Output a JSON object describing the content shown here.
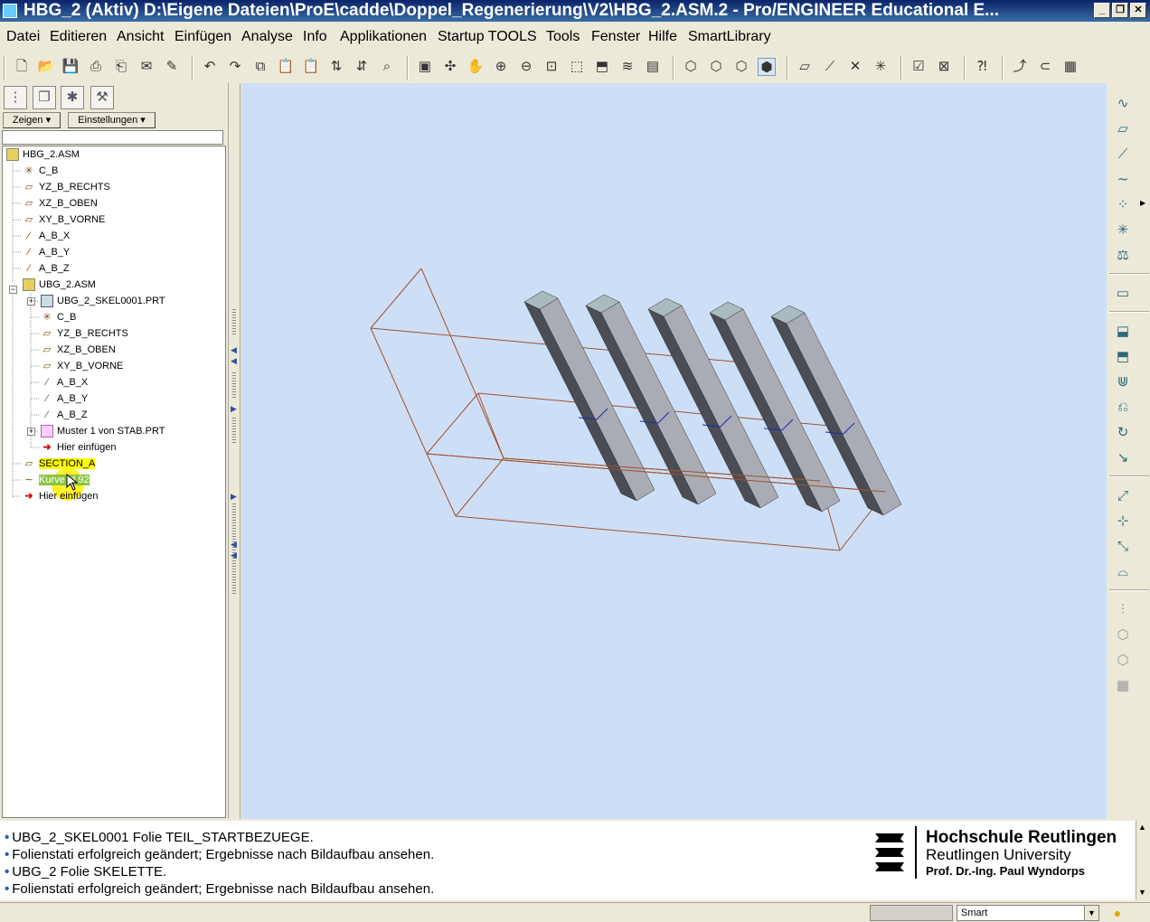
{
  "window": {
    "title": "HBG_2 (Aktiv) D:\\Eigene Dateien\\ProE\\cadde\\Doppel_Regenerierung\\V2\\HBG_2.ASM.2 - Pro/ENGINEER Educational E...",
    "minimize": "_",
    "maximize": "❐",
    "close": "✕"
  },
  "menu": [
    "Datei",
    "Editieren",
    "Ansicht",
    "Einfügen",
    "Analyse",
    "Info",
    "Applikationen",
    "Startup TOOLS",
    "Tools",
    "Fenster",
    "Hilfe",
    "SmartLibrary"
  ],
  "panel": {
    "show_button": "Zeigen ▾",
    "settings_button": "Einstellungen ▾"
  },
  "tree": [
    {
      "label": "HBG_2.ASM",
      "icon": "assembly-icon"
    },
    {
      "label": "C_B",
      "icon": "csys-icon"
    },
    {
      "label": "YZ_B_RECHTS",
      "icon": "plane-icon"
    },
    {
      "label": "XZ_B_OBEN",
      "icon": "plane-icon"
    },
    {
      "label": "XY_B_VORNE",
      "icon": "plane-icon"
    },
    {
      "label": "A_B_X",
      "icon": "axis-icon"
    },
    {
      "label": "A_B_Y",
      "icon": "axis-icon"
    },
    {
      "label": "A_B_Z",
      "icon": "axis-icon"
    },
    {
      "label": "UBG_2.ASM",
      "icon": "assembly-icon"
    },
    {
      "label": "UBG_2_SKEL0001.PRT",
      "icon": "part-icon"
    },
    {
      "label": "C_B",
      "icon": "csys-icon"
    },
    {
      "label": "YZ_B_RECHTS",
      "icon": "plane-icon"
    },
    {
      "label": "XZ_B_OBEN",
      "icon": "plane-icon"
    },
    {
      "label": "XY_B_VORNE",
      "icon": "plane-icon"
    },
    {
      "label": "A_B_X",
      "icon": "axis-icon"
    },
    {
      "label": "A_B_Y",
      "icon": "axis-icon"
    },
    {
      "label": "A_B_Z",
      "icon": "axis-icon"
    },
    {
      "label": "Muster 1 von STAB.PRT",
      "icon": "pattern-icon"
    },
    {
      "label": "Hier einfügen",
      "icon": "insert-here-icon"
    },
    {
      "label": "SECTION_A",
      "icon": "plane-icon"
    },
    {
      "label": "Kurve id 92",
      "icon": "curve-icon"
    },
    {
      "label": "Hier einfügen",
      "icon": "insert-here-icon"
    }
  ],
  "messages": [
    "UBG_2_SKEL0001 Folie TEIL_STARTBEZUEGE.",
    "Folienstati erfolgreich geändert; Ergebnisse nach Bildaufbau ansehen.",
    "UBG_2 Folie SKELETTE.",
    "Folienstati erfolgreich geändert; Ergebnisse nach Bildaufbau ansehen."
  ],
  "logo": {
    "line1": "Hochschule Reutlingen",
    "line2": "Reutlingen University",
    "line3": "Prof. Dr.-Ing. Paul Wyndorps"
  },
  "status": {
    "filter_value": "Smart"
  },
  "colors": {
    "viewport_bg": "#cddff7",
    "wireframe": "#a0522d",
    "bar_top": "#aabbc0",
    "bar_side_dark": "#4a4d55",
    "bar_side_light": "#a9acb5"
  }
}
